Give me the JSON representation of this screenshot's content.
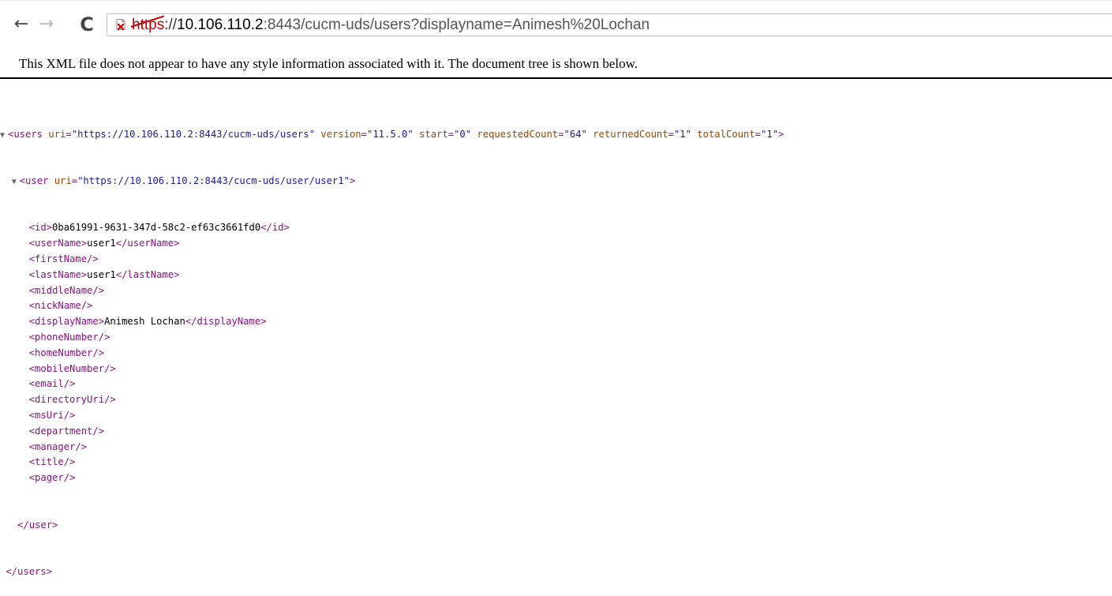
{
  "toolbar": {
    "back_icon": "←",
    "forward_icon": "→",
    "reload_icon": "C",
    "url": {
      "scheme": "https",
      "sep": "://",
      "host": "10.106.110.2",
      "rest": ":8443/cucm-uds/users?displayname=Animesh%20Lochan"
    }
  },
  "notice": "This XML file does not appear to have any style information associated with it. The document tree is shown below.",
  "xml": {
    "expand_marker": "▼",
    "root": {
      "open": "<users",
      "attrs": [
        {
          "name": "uri",
          "value": "\"https://10.106.110.2:8443/cucm-uds/users\""
        },
        {
          "name": "version",
          "value": "\"11.5.0\""
        },
        {
          "name": "start",
          "value": "\"0\""
        },
        {
          "name": "requestedCount",
          "value": "\"64\""
        },
        {
          "name": "returnedCount",
          "value": "\"1\""
        },
        {
          "name": "totalCount",
          "value": "\"1\""
        }
      ],
      "close": "</users>"
    },
    "user": {
      "open": "<user",
      "attr_name": "uri",
      "attr_value": "\"https://10.106.110.2:8443/cucm-uds/user/user1\"",
      "close": "</user>"
    },
    "fields": [
      {
        "open": "<id>",
        "text": "0ba61991-9631-347d-58c2-ef63c3661fd0",
        "close": "</id>"
      },
      {
        "open": "<userName>",
        "text": "user1",
        "close": "</userName>"
      },
      {
        "open": "<firstName/>",
        "text": "",
        "close": ""
      },
      {
        "open": "<lastName>",
        "text": "user1",
        "close": "</lastName>"
      },
      {
        "open": "<middleName/>",
        "text": "",
        "close": ""
      },
      {
        "open": "<nickName/>",
        "text": "",
        "close": ""
      },
      {
        "open": "<displayName>",
        "text": "Animesh Lochan",
        "close": "</displayName>"
      },
      {
        "open": "<phoneNumber/>",
        "text": "",
        "close": ""
      },
      {
        "open": "<homeNumber/>",
        "text": "",
        "close": ""
      },
      {
        "open": "<mobileNumber/>",
        "text": "",
        "close": ""
      },
      {
        "open": "<email/>",
        "text": "",
        "close": ""
      },
      {
        "open": "<directoryUri/>",
        "text": "",
        "close": ""
      },
      {
        "open": "<msUri/>",
        "text": "",
        "close": ""
      },
      {
        "open": "<department/>",
        "text": "",
        "close": ""
      },
      {
        "open": "<manager/>",
        "text": "",
        "close": ""
      },
      {
        "open": "<title/>",
        "text": "",
        "close": ""
      },
      {
        "open": "<pager/>",
        "text": "",
        "close": ""
      }
    ]
  },
  "colors": {
    "tag": "#881280",
    "attr_name": "#994500",
    "attr_value": "#1a1aa6",
    "insecure": "#c40000"
  }
}
